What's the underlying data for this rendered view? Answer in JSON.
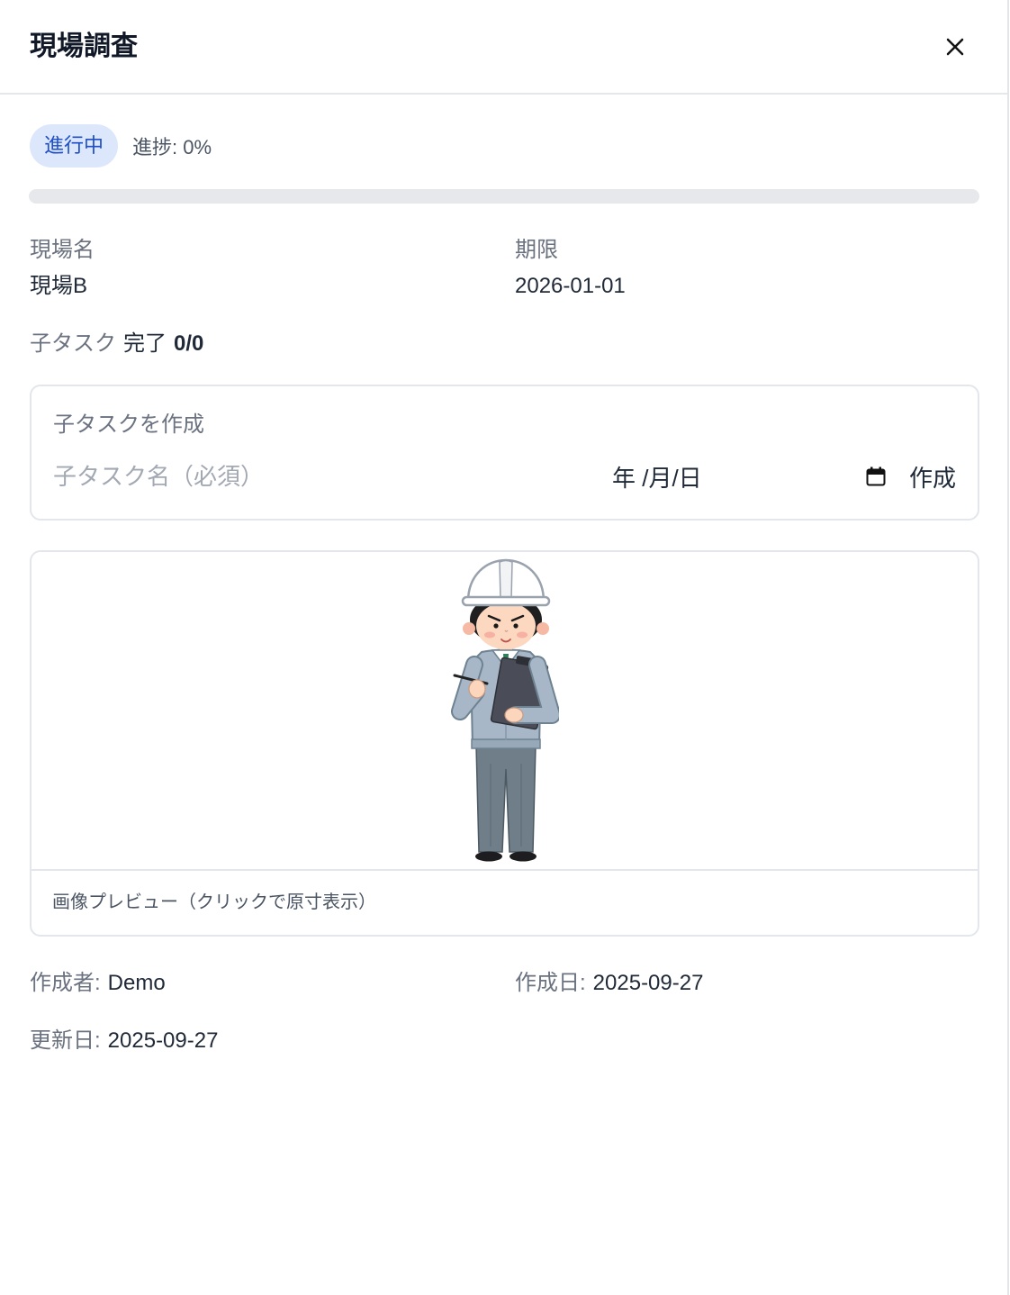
{
  "header": {
    "title": "現場調査",
    "close_icon": "close-icon"
  },
  "status": {
    "badge": "進行中",
    "progress": {
      "label": "進捗: 0%",
      "value": 0
    }
  },
  "details": {
    "site_label": "現場名",
    "site_value": "現場B",
    "due_label": "期限",
    "due_value": "2026-01-01"
  },
  "subtasks": {
    "label": "子タスク",
    "done_label": "完了",
    "count": "0/0"
  },
  "create_subtask": {
    "title": "子タスクを作成",
    "name_placeholder": "子タスク名（必須）",
    "date_placeholder": "年 /月/日",
    "calendar_icon": "calendar-icon",
    "submit_label": "作成"
  },
  "image_preview": {
    "illustration": "construction-worker-illustration",
    "caption": "画像プレビュー（クリックで原寸表示）"
  },
  "meta": {
    "author_label": "作成者:",
    "author_value": "Demo",
    "created_label": "作成日:",
    "created_value": "2025-09-27",
    "updated_label": "更新日:",
    "updated_value": "2025-09-27"
  },
  "colors": {
    "badge_bg": "#dce7fc",
    "badge_text": "#1e4fc7",
    "progress_track": "#e6e8ec",
    "progress_fill": "#2563eb"
  }
}
